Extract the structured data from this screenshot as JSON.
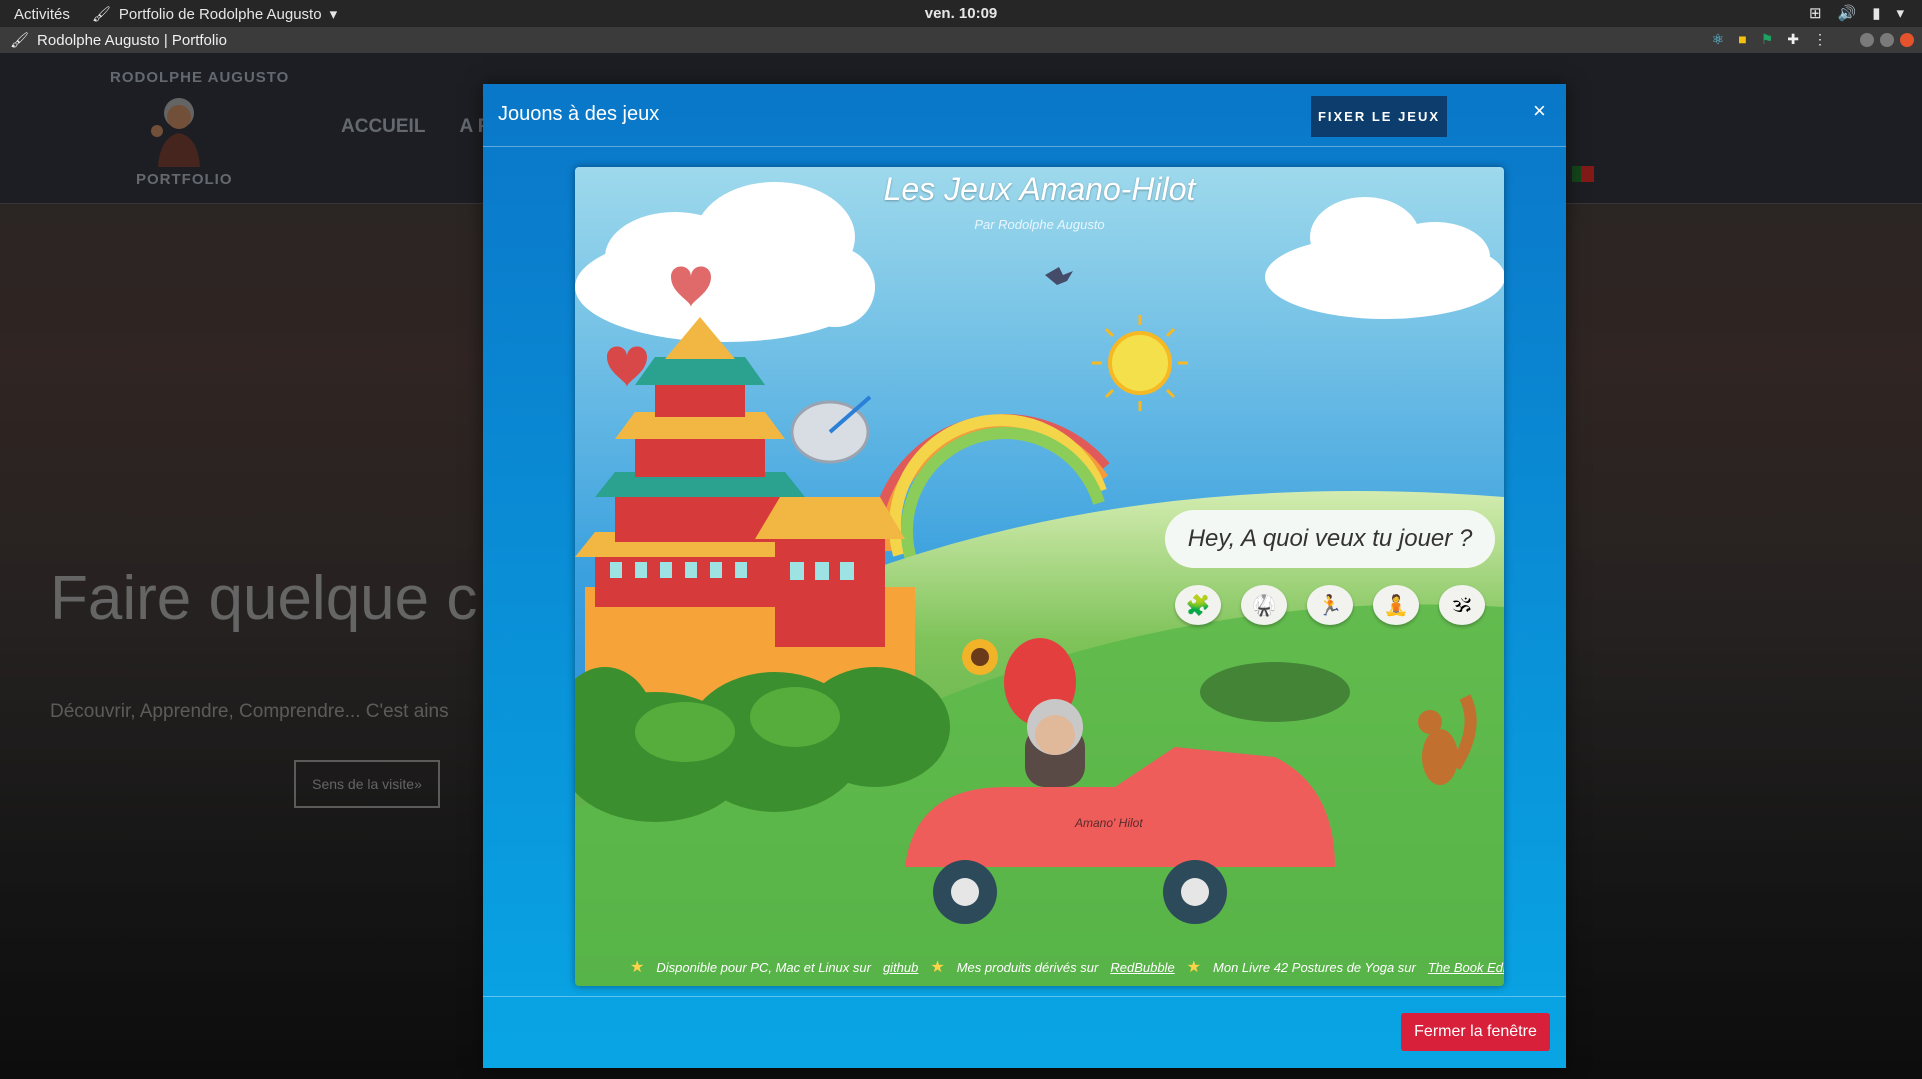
{
  "desktop": {
    "activities": "Activités",
    "app_name": "Portfolio de Rodolphe Augusto",
    "clock": "ven. 10:09"
  },
  "window": {
    "title": "Rodolphe Augusto | Portfolio"
  },
  "site": {
    "brand_name": "RODOLPHE AUGUSTO",
    "brand_sub": "PORTFOLIO",
    "nav": [
      "ACCUEIL",
      "A P"
    ],
    "hero_title": "Faire quelque c",
    "hero_sub": "Découvrir, Apprendre, Comprendre... C'est ains",
    "hero_button": "Sens de la visite»"
  },
  "modal": {
    "title": "Jouons à des jeux",
    "fix_button": "FIXER LE JEUX",
    "close_icon": "×",
    "close_button": "Fermer la fenêtre"
  },
  "game": {
    "title": "Les Jeux Amano-Hilot",
    "subtitle": "Par Rodolphe Augusto",
    "speech": "Hey, A quoi veux tu jouer ?",
    "car_label": "Amano' Hilot",
    "choices": [
      "puzzle-game-icon",
      "martial-arts-game-icon",
      "running-game-icon",
      "yoga-game-icon",
      "meditation-game-icon"
    ],
    "footer": {
      "item1_text": "Disponible pour PC, Mac et Linux sur",
      "item1_link": "github",
      "item2_text": "Mes produits dérivés sur",
      "item2_link": "RedBubble",
      "item3_text": "Mon Livre 42 Postures de Yoga sur",
      "item3_link": "The Book Edition"
    }
  },
  "colors": {
    "modal_top": "#0a77c8",
    "modal_bottom": "#09a5e4",
    "fix_button_bg": "#0c3d6c",
    "close_button_bg": "#d9203a",
    "sky": "#4fb3e4",
    "grass": "#5cb84a",
    "car": "#ef5d5a"
  }
}
